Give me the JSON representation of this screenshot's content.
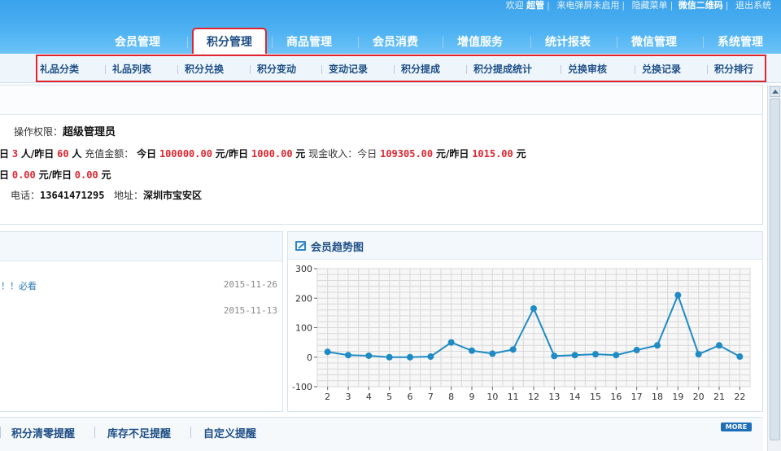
{
  "toplinks": {
    "welcome": "欢迎",
    "user": "超管",
    "notice": "来电弹屏未启用",
    "hide_menu": "隐藏菜单",
    "wechat_qr": "微信二维码",
    "logout": "退出系统"
  },
  "main_nav": [
    {
      "label": "会员管理",
      "active": false
    },
    {
      "label": "积分管理",
      "active": true
    },
    {
      "label": "商品管理",
      "active": false
    },
    {
      "label": "会员消费",
      "active": false
    },
    {
      "label": "增值服务",
      "active": false
    },
    {
      "label": "统计报表",
      "active": false
    },
    {
      "label": "微信管理",
      "active": false
    },
    {
      "label": "系统管理",
      "active": false
    }
  ],
  "sub_nav": [
    "礼品分类",
    "礼品列表",
    "积分兑换",
    "积分变动",
    "变动记录",
    "积分提成",
    "积分提成统计",
    "兑换审核",
    "兑换记录",
    "积分排行"
  ],
  "info": {
    "perm_label": "操作权限：",
    "perm_value": "超级管理员",
    "line1": {
      "prefix": "日",
      "members_today": "3",
      "unit1": "人/昨日",
      "members_yesterday": "60",
      "unit2": "人",
      "recharge_label": "充值金额：",
      "today_label": "今日",
      "recharge_today": "100000.00",
      "unit3": "元/昨日",
      "recharge_yesterday": "1000.00",
      "unit4": "元",
      "cash_label": "现金收入：今日",
      "cash_today": "109305.00",
      "unit5": "元/昨日",
      "cash_yesterday": "1015.00",
      "unit6": "元"
    },
    "line2": {
      "prefix": "日",
      "v1": "0.00",
      "unit1": "元/昨日",
      "v2": "0.00",
      "unit2": "元"
    },
    "phone_label": "电话：",
    "phone": "13641471295",
    "address_label": "地址：",
    "address": "深圳市宝安区"
  },
  "news": [
    {
      "title": "！！必看",
      "date": "2015-11-26"
    },
    {
      "title": "",
      "date": "2015-11-13"
    }
  ],
  "chart_panel_title": "会员趋势图",
  "chart_data": {
    "type": "line",
    "title": "会员趋势图",
    "x": [
      2,
      3,
      4,
      5,
      6,
      7,
      8,
      9,
      10,
      11,
      12,
      13,
      14,
      15,
      16,
      17,
      18,
      19,
      20,
      21,
      22
    ],
    "y": [
      18,
      7,
      5,
      0,
      0,
      2,
      50,
      22,
      12,
      26,
      165,
      4,
      7,
      10,
      7,
      24,
      40,
      210,
      10,
      40,
      2
    ],
    "ylim": [
      -100,
      300
    ],
    "yticks": [
      -100,
      0,
      100,
      200,
      300
    ],
    "grid": true,
    "color": "#1f8bc5",
    "xlabel": "",
    "ylabel": ""
  },
  "bottom_links": [
    "积分清零提醒",
    "库存不足提醒",
    "自定义提醒"
  ],
  "more_label": "MORE",
  "colors": {
    "header": "#4fb3f3",
    "accent_red": "#e0252f",
    "nav_text": "#1f4f86"
  }
}
